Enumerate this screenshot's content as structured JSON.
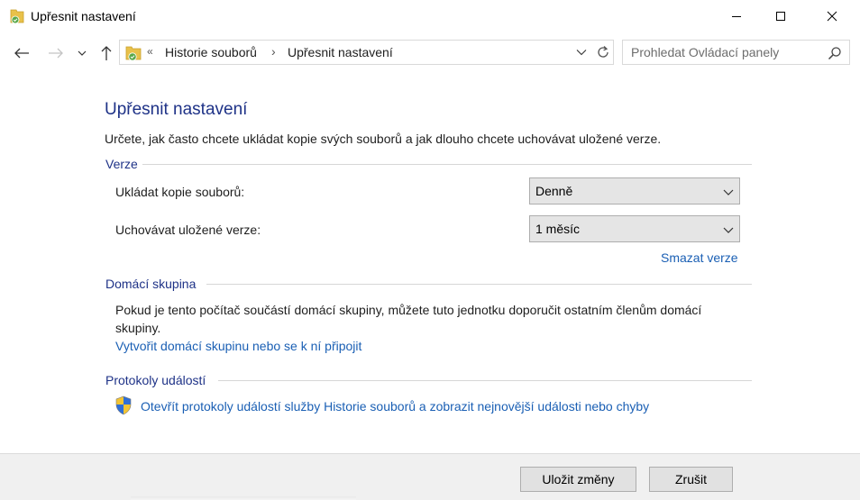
{
  "window": {
    "title": "Upřesnit nastavení"
  },
  "address_bar": {
    "overflow_marker": "«",
    "breadcrumbs": [
      "Historie souborů",
      "Upřesnit nastavení"
    ],
    "separator": "›"
  },
  "search": {
    "placeholder": "Prohledat Ovládací panely"
  },
  "page": {
    "heading": "Upřesnit nastavení",
    "description": "Určete, jak často chcete ukládat kopie svých souborů a jak dlouho chcete uchovávat uložené verze."
  },
  "versions": {
    "label": "Verze",
    "save_copies_label": "Ukládat kopie souborů:",
    "save_copies_value": "Denně",
    "keep_versions_label": "Uchovávat uložené verze:",
    "keep_versions_value": "1 měsíc",
    "clean_up_link": "Smazat verze"
  },
  "homegroup": {
    "label": "Domácí skupina",
    "text": "Pokud je tento počítač součástí domácí skupiny, můžete tuto jednotku doporučit ostatním členům domácí skupiny.",
    "link": "Vytvořit domácí skupinu nebo se k ní připojit"
  },
  "event_logs": {
    "label": "Protokoly událostí",
    "link": "Otevřít protokoly událostí služby Historie souborů a zobrazit nejnovější události nebo chyby"
  },
  "footer": {
    "save_label": "Uložit změny",
    "cancel_label": "Zrušit"
  },
  "colors": {
    "heading": "#1e3287",
    "link": "#1a5fb4",
    "footer_bg": "#f0f0f0"
  },
  "icons": [
    "file-history-icon",
    "back-arrow-icon",
    "forward-arrow-icon",
    "recent-locations-icon",
    "up-arrow-icon",
    "folder-icon",
    "chevron-down-icon",
    "refresh-icon",
    "search-icon",
    "shield-icon"
  ]
}
